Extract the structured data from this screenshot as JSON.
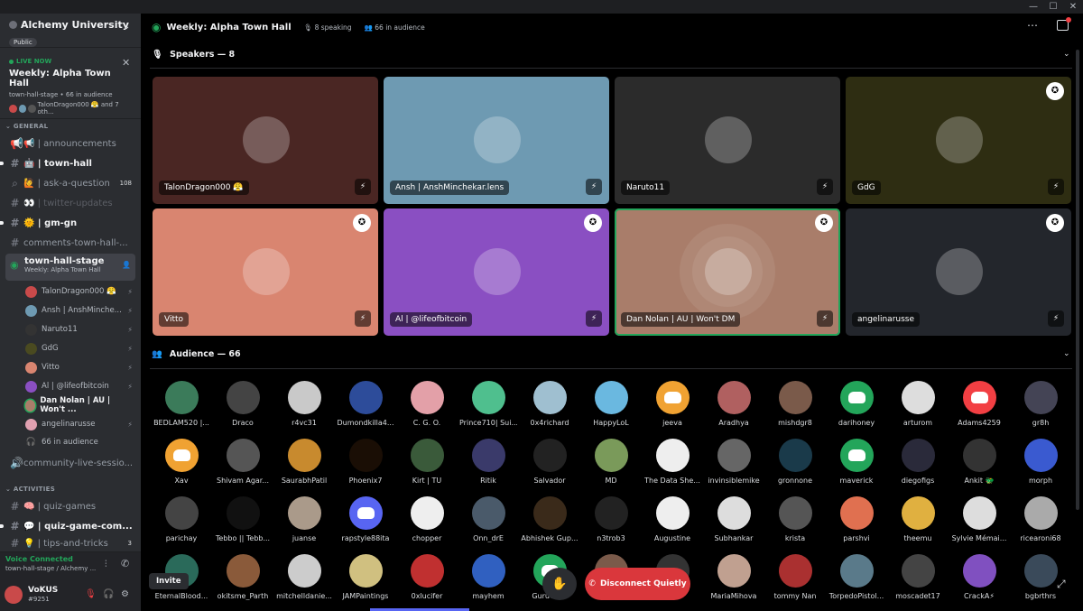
{
  "window": {
    "minimize": "—",
    "maximize": "☐",
    "close": "✕"
  },
  "server": {
    "name": "Alchemy University",
    "badge": "Public"
  },
  "live": {
    "label": "LIVE NOW",
    "title": "Weekly: Alpha Town Hall",
    "sub": "town-hall-stage • 66 in audience",
    "people": "TalonDragon000 😤 and 7 oth..."
  },
  "categories": {
    "general": "GENERAL",
    "activities": "ACTIVITIES"
  },
  "channels": [
    {
      "name": "📢 | announcements",
      "count": ""
    },
    {
      "name": "🤖 | town-hall",
      "count": ""
    },
    {
      "name": "🙋 | ask-a-question",
      "count": "108"
    },
    {
      "name": "👀 | twitter-updates",
      "count": ""
    },
    {
      "name": "🌞 | gm-gn",
      "count": ""
    },
    {
      "name": "comments-town-hall-...",
      "count": ""
    },
    {
      "name": "community-live-sessio...",
      "count": ""
    },
    {
      "name": "🧠 | quiz-games",
      "count": ""
    },
    {
      "name": "💬 | quiz-game-com...",
      "count": ""
    },
    {
      "name": "💡 | tips-and-tricks",
      "count": "3"
    }
  ],
  "stage_channel": {
    "name": "town-hall-stage",
    "sub": "Weekly: Alpha Town Hall"
  },
  "voice_users": [
    "TalonDragon000 😤",
    "Ansh | AnshMinche...",
    "Naruto11",
    "GdG",
    "Vitto",
    "Al | @lifeofbitcoin",
    "Dan Nolan | AU | Won't ...",
    "angelinarusse"
  ],
  "voice_audience": "66 in audience",
  "voice_connected": {
    "status": "Voice Connected",
    "channel": "town-hall-stage / Alchemy ..."
  },
  "user": {
    "name": "VoKUS",
    "tag": "#9251"
  },
  "topbar": {
    "title": "Weekly: Alpha Town Hall",
    "speaking": "8 speaking",
    "audience": "66 in audience"
  },
  "speakers": {
    "title": "Speakers — 8"
  },
  "audience": {
    "title": "Audience — 66"
  },
  "tiles": [
    {
      "name": "TalonDragon000 😤",
      "bg": "#4a2623",
      "mod": false,
      "speaking": false
    },
    {
      "name": "Ansh | AnshMinchekar.lens",
      "bg": "#6e9ab2",
      "mod": false,
      "speaking": false
    },
    {
      "name": "Naruto11",
      "bg": "#2b2b2b",
      "mod": false,
      "speaking": false
    },
    {
      "name": "GdG",
      "bg": "#2e2d12",
      "mod": true,
      "speaking": false
    },
    {
      "name": "Vitto",
      "bg": "#d98570",
      "mod": true,
      "speaking": false
    },
    {
      "name": "Al | @lifeofbitcoin",
      "bg": "#8a4fc2",
      "mod": true,
      "speaking": false
    },
    {
      "name": "Dan Nolan | AU | Won't DM",
      "bg": "#a97d6a",
      "mod": true,
      "speaking": true
    },
    {
      "name": "angelinarusse",
      "bg": "#23262c",
      "mod": true,
      "speaking": false
    }
  ],
  "audience_members": [
    {
      "name": "BEDLAM520 |...",
      "color": "#3b7b5a"
    },
    {
      "name": "Draco",
      "color": "#444"
    },
    {
      "name": "r4vc31",
      "color": "#c9c9c9"
    },
    {
      "name": "Dumondkilla4...",
      "color": "#2d4c9a"
    },
    {
      "name": "C. G. O.",
      "color": "#e3a0a8"
    },
    {
      "name": "Prince710| Sui...",
      "color": "#4fbf8e"
    },
    {
      "name": "0x4richard",
      "color": "#9fbfd0"
    },
    {
      "name": "HappyLoL",
      "color": "#6ab8e0"
    },
    {
      "name": "jeeva",
      "color": "#f0a232",
      "discord": true
    },
    {
      "name": "Aradhya",
      "color": "#b06060"
    },
    {
      "name": "mishdgr8",
      "color": "#7a5a4a"
    },
    {
      "name": "darihoney",
      "color": "#23a55a",
      "discord": true
    },
    {
      "name": "arturom",
      "color": "#ddd"
    },
    {
      "name": "Adams4259",
      "color": "#f23f43",
      "discord": true
    },
    {
      "name": "gr8h",
      "color": "#445"
    },
    {
      "name": "Xav",
      "color": "#f0a232",
      "discord": true
    },
    {
      "name": "Shivam Agar...",
      "color": "#555"
    },
    {
      "name": "SaurabhPatil",
      "color": "#c88a2e"
    },
    {
      "name": "Phoenix7",
      "color": "#1a0e05"
    },
    {
      "name": "Kirt | TU",
      "color": "#3a5a3a"
    },
    {
      "name": "Ritik",
      "color": "#3a3a6a"
    },
    {
      "name": "Salvador",
      "color": "#222"
    },
    {
      "name": "MD",
      "color": "#7a9a5a"
    },
    {
      "name": "The Data She...",
      "color": "#eee"
    },
    {
      "name": "invinsiblemike",
      "color": "#666"
    },
    {
      "name": "gronnone",
      "color": "#1a3a4a"
    },
    {
      "name": "maverick",
      "color": "#23a55a",
      "discord": true
    },
    {
      "name": "diegofigs",
      "color": "#2a2a3a"
    },
    {
      "name": "Ankit 🐲",
      "color": "#333"
    },
    {
      "name": "morph",
      "color": "#3a5ad0"
    },
    {
      "name": "parichay",
      "color": "#444"
    },
    {
      "name": "Tebbo || Tebb...",
      "color": "#111"
    },
    {
      "name": "juanse",
      "color": "#aa9a8a"
    },
    {
      "name": "rapstyle88ita",
      "color": "#5865f2",
      "discord": true
    },
    {
      "name": "chopper",
      "color": "#eee"
    },
    {
      "name": "Onn_drE",
      "color": "#4a5a6a"
    },
    {
      "name": "Abhishek Gup...",
      "color": "#3a2a1a"
    },
    {
      "name": "n3trob3",
      "color": "#222"
    },
    {
      "name": "Augustine",
      "color": "#eee"
    },
    {
      "name": "Subhankar",
      "color": "#ddd"
    },
    {
      "name": "krista",
      "color": "#555"
    },
    {
      "name": "parshvi",
      "color": "#e07050"
    },
    {
      "name": "theemu",
      "color": "#e0b040"
    },
    {
      "name": "Sylvie Mémai...",
      "color": "#ddd"
    },
    {
      "name": "ricearoni68",
      "color": "#aaa"
    },
    {
      "name": "EternalBlood...",
      "color": "#2a6a5a"
    },
    {
      "name": "okitsme_Parth",
      "color": "#8a5a3a"
    },
    {
      "name": "mitchelldanie...",
      "color": "#ccc"
    },
    {
      "name": "JAMPaintings",
      "color": "#d0c080"
    },
    {
      "name": "0xlucifer",
      "color": "#c03030"
    },
    {
      "name": "mayhem",
      "color": "#3060c0"
    },
    {
      "name": "Guruvig...",
      "color": "#23a55a",
      "discord": true
    },
    {
      "name": "",
      "color": "#7a5a4a"
    },
    {
      "name": "",
      "color": "#333"
    },
    {
      "name": "MariaMihova",
      "color": "#c0a090"
    },
    {
      "name": "tommy Nan",
      "color": "#aa3030"
    },
    {
      "name": "TorpedoPistol...",
      "color": "#5a7a8a"
    },
    {
      "name": "moscadet17",
      "color": "#444"
    },
    {
      "name": "CrackA⚡",
      "color": "#8050c0"
    },
    {
      "name": "bgbrthrs",
      "color": "#3a4a5a"
    }
  ],
  "buttons": {
    "invite": "Invite",
    "disconnect": "Disconnect Quietly"
  }
}
